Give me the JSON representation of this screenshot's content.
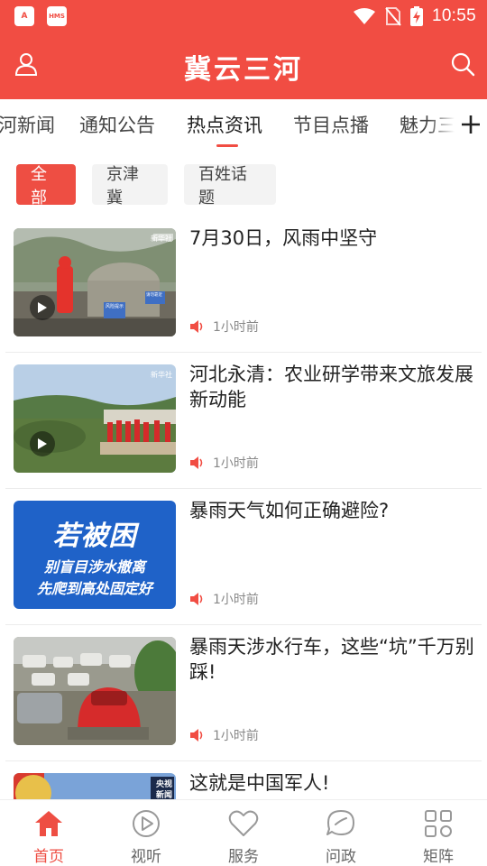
{
  "status_bar": {
    "app_icon_1": "A",
    "app_icon_2": "HMS",
    "time": "10:55"
  },
  "header": {
    "title": "冀云三河",
    "user_icon": "user-icon",
    "search_icon": "search-icon"
  },
  "tabs": [
    {
      "label": "河新闻",
      "active": false
    },
    {
      "label": "通知公告",
      "active": false
    },
    {
      "label": "热点资讯",
      "active": true
    },
    {
      "label": "节目点播",
      "active": false
    },
    {
      "label": "魅力三河",
      "active": false
    }
  ],
  "chips": [
    {
      "label": "全部",
      "active": true
    },
    {
      "label": "京津冀",
      "active": false
    },
    {
      "label": "百姓话题",
      "active": false
    }
  ],
  "feed": [
    {
      "headline": "7月30日，风雨中坚守",
      "time": "1小时前",
      "video": true,
      "thumb_texts": [
        "新华社",
        "风险提示",
        "请勿靠近"
      ]
    },
    {
      "headline": "河北永清：农业研学带来文旅发展新动能",
      "time": "1小时前",
      "video": true,
      "thumb_texts": [
        "新华社"
      ]
    },
    {
      "headline": "暴雨天气如何正确避险?",
      "time": "1小时前",
      "video": false,
      "thumb_texts": [
        "若被困",
        "别盲目涉水撤离",
        "先爬到高处固定好"
      ]
    },
    {
      "headline": "暴雨天涉水行车，这些“坑”千万别踩!",
      "time": "1小时前",
      "video": false,
      "thumb_texts": []
    },
    {
      "headline": "这就是中国军人!",
      "time": "",
      "video": false,
      "thumb_texts": [
        "央视",
        "新闻"
      ]
    }
  ],
  "bottom_nav": [
    {
      "label": "首页",
      "icon": "home-icon",
      "active": true
    },
    {
      "label": "视听",
      "icon": "play-circle-icon",
      "active": false
    },
    {
      "label": "服务",
      "icon": "heart-icon",
      "active": false
    },
    {
      "label": "问政",
      "icon": "chat-icon",
      "active": false
    },
    {
      "label": "矩阵",
      "icon": "grid-icon",
      "active": false
    }
  ],
  "colors": {
    "brand_red": "#f14d43",
    "text_dark": "#222222",
    "text_meta": "#888888"
  }
}
